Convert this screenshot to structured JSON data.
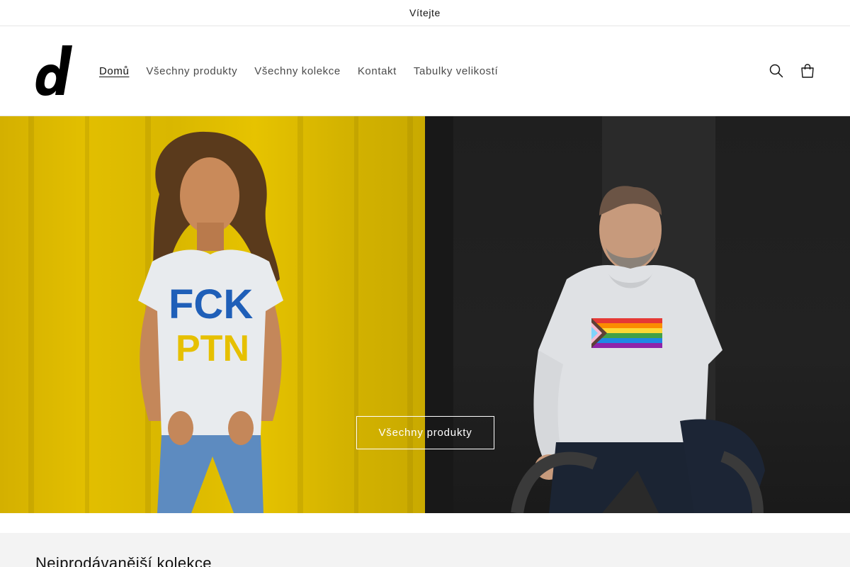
{
  "announcement": {
    "text": "Vítejte"
  },
  "header": {
    "logo_alt": "d",
    "nav": [
      {
        "label": "Domů",
        "active": true
      },
      {
        "label": "Všechny produkty",
        "active": false
      },
      {
        "label": "Všechny kolekce",
        "active": false
      },
      {
        "label": "Kontakt",
        "active": false
      },
      {
        "label": "Tabulky velikostí",
        "active": false
      }
    ],
    "icons": {
      "search": "search-icon",
      "cart": "cart-icon"
    }
  },
  "hero": {
    "button_label": "Všechny produkty",
    "left_shirt_text_line1": "FCK",
    "left_shirt_text_line2": "PTN",
    "colors": {
      "left_bg": "#d9b700",
      "right_bg": "#1f1f1f",
      "shirt_blue": "#1f5fb8",
      "shirt_yellow": "#e6c000"
    }
  },
  "featured": {
    "title": "Nejprodávanější kolekce"
  }
}
